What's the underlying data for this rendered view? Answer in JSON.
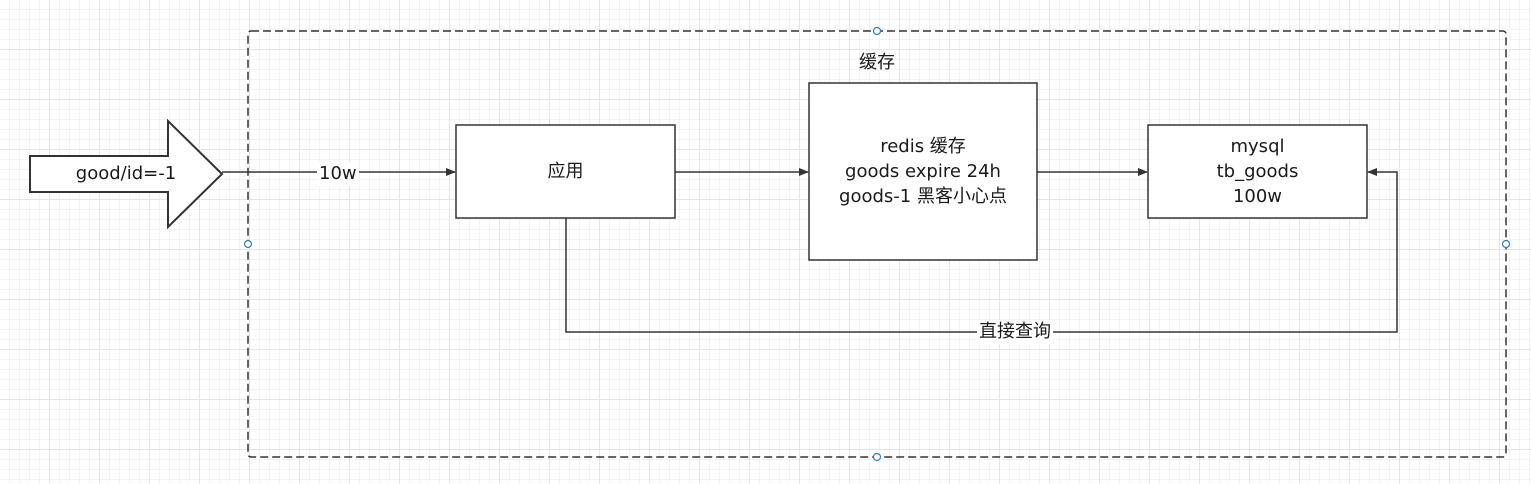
{
  "colors": {
    "stroke": "#333333",
    "text": "#1a1a1a",
    "handle": "#2f7fbf",
    "grid": "#e4e4e4"
  },
  "arrow_shape": {
    "label": "good/id=-1"
  },
  "edges": {
    "request_label": "10w",
    "direct_query_label": "直接查询"
  },
  "cache_title": "缓存",
  "boxes": {
    "app": {
      "lines": [
        "应用"
      ]
    },
    "redis": {
      "lines": [
        "redis 缓存",
        "goods expire 24h",
        "goods-1 黑客小心点"
      ]
    },
    "mysql": {
      "lines": [
        "mysql",
        "tb_goods",
        "100w"
      ]
    }
  }
}
